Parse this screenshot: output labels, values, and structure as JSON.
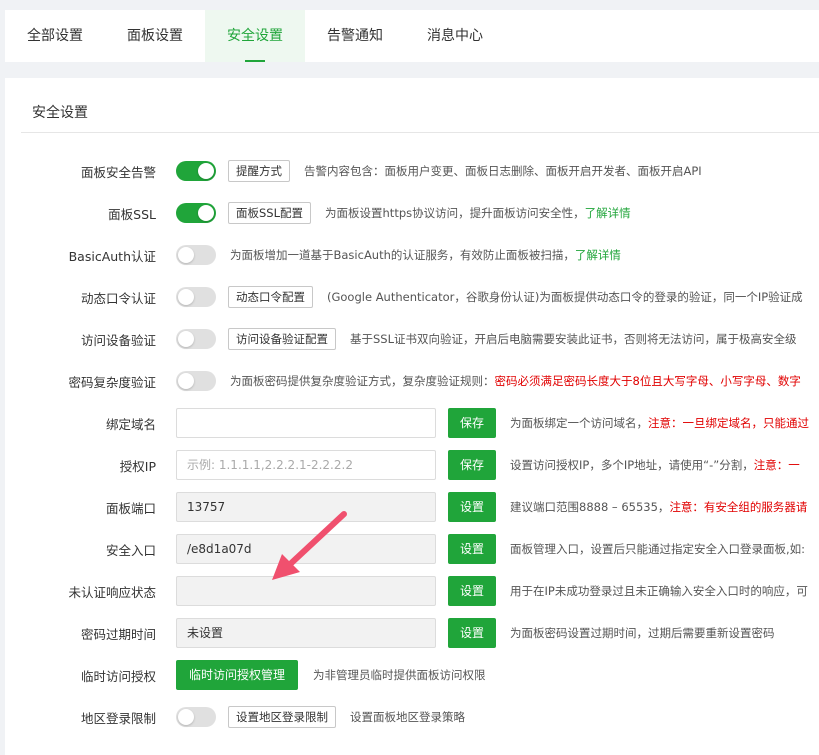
{
  "tabs": [
    "全部设置",
    "面板设置",
    "安全设置",
    "告警通知",
    "消息中心"
  ],
  "section_title": "安全设置",
  "rows": {
    "alarm": {
      "label": "面板安全告警",
      "button": "提醒方式",
      "desc": "告警内容包含：面板用户变更、面板日志删除、面板开启开发者、面板开启API"
    },
    "ssl": {
      "label": "面板SSL",
      "button": "面板SSL配置",
      "desc": "为面板设置https协议访问，提升面板访问安全性，",
      "link": "了解详情"
    },
    "basicauth": {
      "label": "BasicAuth认证",
      "desc": "为面板增加一道基于BasicAuth的认证服务，有效防止面板被扫描，",
      "link": "了解详情"
    },
    "otp": {
      "label": "动态口令认证",
      "button": "动态口令配置",
      "desc": "(Google Authenticator，谷歌身份认证)为面板提供动态口令的登录的验证，同一个IP验证成"
    },
    "device": {
      "label": "访问设备验证",
      "button": "访问设备验证配置",
      "desc": "基于SSL证书双向验证，开启后电脑需要安装此证书，否则将无法访问，属于极高安全级"
    },
    "pwcomplex": {
      "label": "密码复杂度验证",
      "desc": "为面板密码提供复杂度验证方式，复杂度验证规则：",
      "red": "密码必须满足密码长度大于8位且大写字母、小写字母、数字"
    },
    "domain": {
      "label": "绑定域名",
      "value": "",
      "button": "保存",
      "desc": "为面板绑定一个访问域名，",
      "red": "注意：一旦绑定域名，只能通过"
    },
    "authip": {
      "label": "授权IP",
      "placeholder": "示例: 1.1.1.1,2.2.2.1-2.2.2.2",
      "button": "保存",
      "desc": "设置访问授权IP，多个IP地址，请使用“-”分割，",
      "red": "注意：一"
    },
    "port": {
      "label": "面板端口",
      "value": "13757",
      "button": "设置",
      "desc": "建议端口范围8888 – 65535，",
      "red": "注意：有安全组的服务器请"
    },
    "entry": {
      "label": "安全入口",
      "value": "/e8d1a07d",
      "button": "设置",
      "desc": "面板管理入口，设置后只能通过指定安全入口登录面板,如:"
    },
    "unauth": {
      "label": "未认证响应状态",
      "value": "",
      "button": "设置",
      "desc": "用于在IP未成功登录过且未正确输入安全入口时的响应，可"
    },
    "pwexpire": {
      "label": "密码过期时间",
      "value": "未设置",
      "button": "设置",
      "desc": "为面板密码设置过期时间，过期后需要重新设置密码"
    },
    "tempaccess": {
      "label": "临时访问授权",
      "button": "临时访问授权管理",
      "desc": "为非管理员临时提供面板访问权限"
    },
    "region": {
      "label": "地区登录限制",
      "button": "设置地区登录限制",
      "desc": "设置面板地区登录策略"
    }
  },
  "toggles": {
    "alarm": true,
    "ssl": true,
    "basicauth": false,
    "otp": false,
    "device": false,
    "pwcomplex": false,
    "region": false
  },
  "colors": {
    "accent": "#20a53a",
    "warning": "#e10000",
    "arrow": "#f0506e"
  }
}
